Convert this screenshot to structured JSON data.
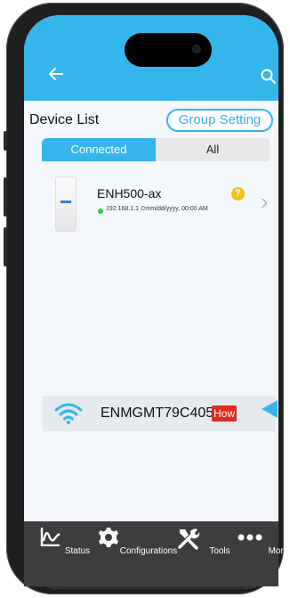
{
  "appbar": {
    "back_icon": "back-arrow-icon",
    "search_icon": "search-icon",
    "color": "#34b6ec"
  },
  "device_list": {
    "title": "Device List",
    "group_setting_label": "Group Setting",
    "tabs": [
      {
        "label": "Connected",
        "active": true
      },
      {
        "label": "All",
        "active": false
      }
    ],
    "devices": [
      {
        "name": "ENH500-ax",
        "ip": "192.168.1.1",
        "timestamp": "mm/dd/yyyy, 00:00 AM",
        "status": "online"
      }
    ]
  },
  "wifi": {
    "ssid": "ENMGMT79C405",
    "help_label": "How"
  },
  "nav": [
    {
      "label": "Status",
      "icon": "status-chart-icon"
    },
    {
      "label": "Configurations",
      "icon": "gear-icon"
    },
    {
      "label": "Tools",
      "icon": "tools-icon"
    },
    {
      "label": "More",
      "icon": "more-dots-icon"
    }
  ]
}
